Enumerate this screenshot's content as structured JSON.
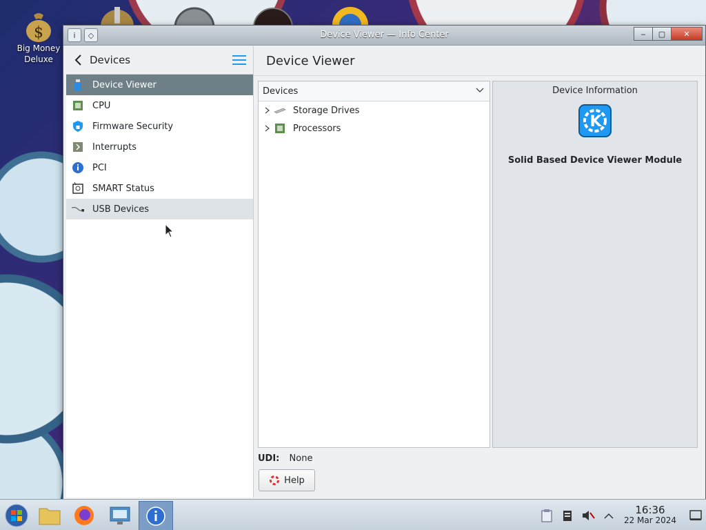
{
  "desktop": {
    "icons": [
      {
        "label": "Big Money Deluxe"
      }
    ]
  },
  "window": {
    "title": "Device Viewer — Info Center",
    "buttons": {
      "minimize": "‒",
      "maximize": "▢",
      "close": "✕"
    }
  },
  "sidebar": {
    "title": "Devices",
    "items": [
      {
        "label": "Device Viewer"
      },
      {
        "label": "CPU"
      },
      {
        "label": "Firmware Security"
      },
      {
        "label": "Interrupts"
      },
      {
        "label": "PCI"
      },
      {
        "label": "SMART Status"
      },
      {
        "label": "USB Devices"
      }
    ]
  },
  "main": {
    "title": "Device Viewer",
    "tree": {
      "header": "Devices",
      "rows": [
        {
          "label": "Storage Drives"
        },
        {
          "label": "Processors"
        }
      ]
    },
    "info": {
      "title": "Device Information",
      "module": "Solid Based Device Viewer Module"
    },
    "udi": {
      "label": "UDI:",
      "value": "None"
    },
    "help": "Help"
  },
  "taskbar": {
    "clock": {
      "time": "16:36",
      "date": "22 Mar 2024"
    }
  },
  "colors": {
    "selection": "#6e7f88",
    "accent": "#3daee9",
    "kde_blue": "#1d99f3"
  }
}
